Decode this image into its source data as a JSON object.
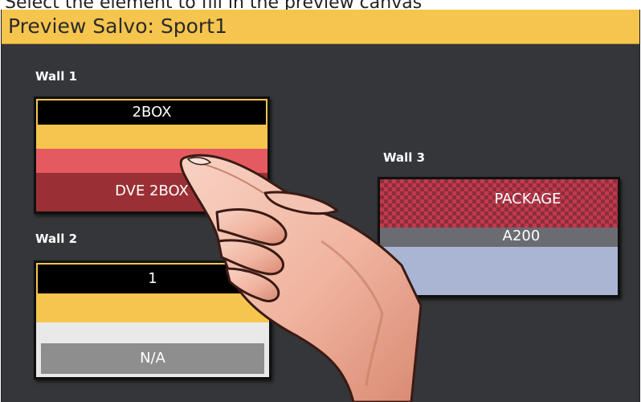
{
  "instruction": "Select the element to fill in the preview canvas",
  "header": {
    "title": "Preview Salvo: Sport1"
  },
  "walls": [
    {
      "label": "Wall 1",
      "top_text": "2BOX",
      "bottom_text": "DVE 2BOX"
    },
    {
      "label": "Wall 2",
      "top_text": "1",
      "bottom_text": "N/A"
    },
    {
      "label": "Wall 3",
      "top_text": "PACKAGE",
      "bottom_text": "A200"
    }
  ],
  "colors": {
    "header_bg": "#f6c54e",
    "panel_bg": "#343639",
    "wall1_accent": "#e55a61",
    "wall1_dark": "#9a3035",
    "wall2_light": "#e9e9e9",
    "wall2_gray": "#8e8e8e",
    "wall3_fill": "#a9b5d3",
    "wall3_gray": "#6a6c72",
    "wall_border_yellow": "#f6c54e"
  },
  "icons": {
    "pointer": "pointing-hand-icon"
  }
}
